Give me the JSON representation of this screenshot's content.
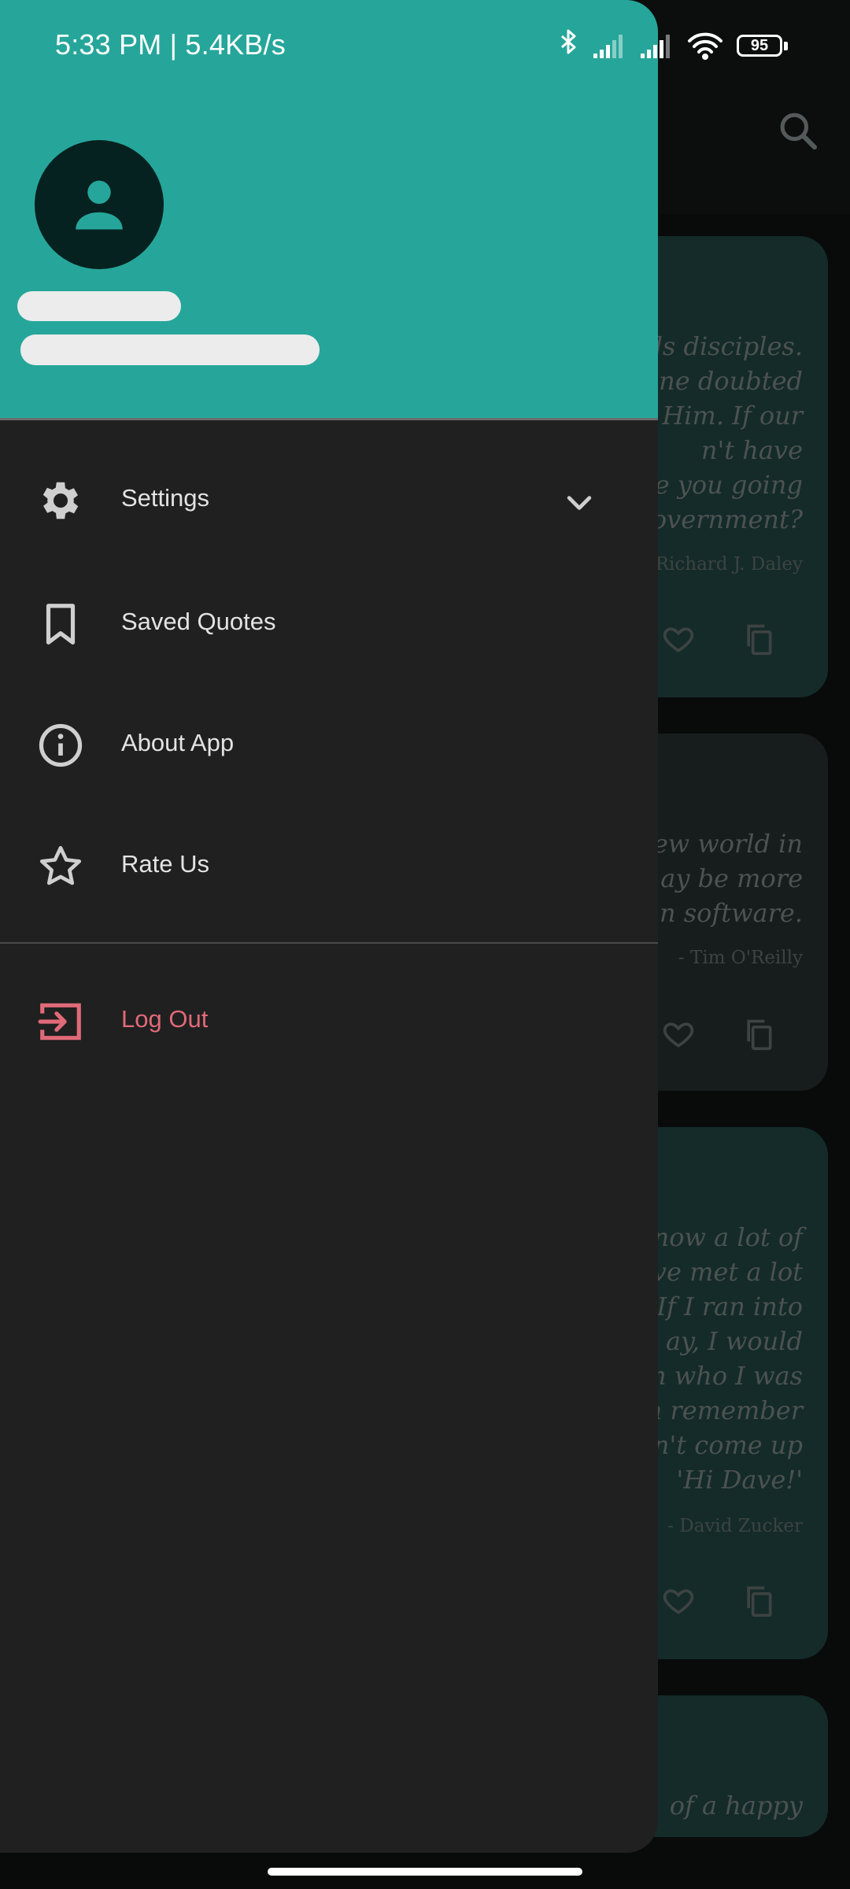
{
  "status_bar": {
    "time": "5:33 PM | 5.4KB/s",
    "battery": "95"
  },
  "background": {
    "cards": [
      {
        "quote": "ds disciples.\none doubted\nd Him. If our\nn't have\nare you going\ngovernment?",
        "author": "Richard J. Daley"
      },
      {
        "quote": "new world in\nay be more\nn software.",
        "author": "- Tim O'Reilly"
      },
      {
        "quote": "now a lot of\n've met a lot\n. If I ran into\nay, I would\nim who I was\nen remember\ndn't come up\n'Hi Dave!'",
        "author": "- David Zucker"
      },
      {
        "quote": "of a happy",
        "author": ""
      }
    ]
  },
  "drawer": {
    "menu": [
      {
        "label": "Settings",
        "icon": "gear-icon"
      },
      {
        "label": "Saved Quotes",
        "icon": "bookmark-icon"
      },
      {
        "label": "About App",
        "icon": "info-icon"
      },
      {
        "label": "Rate Us",
        "icon": "star-icon"
      }
    ],
    "logout": {
      "label": "Log Out",
      "icon": "logout-icon"
    }
  },
  "colors": {
    "header": "#26a69a",
    "drawer_bg": "#202020",
    "logout_accent": "#e06a78"
  }
}
